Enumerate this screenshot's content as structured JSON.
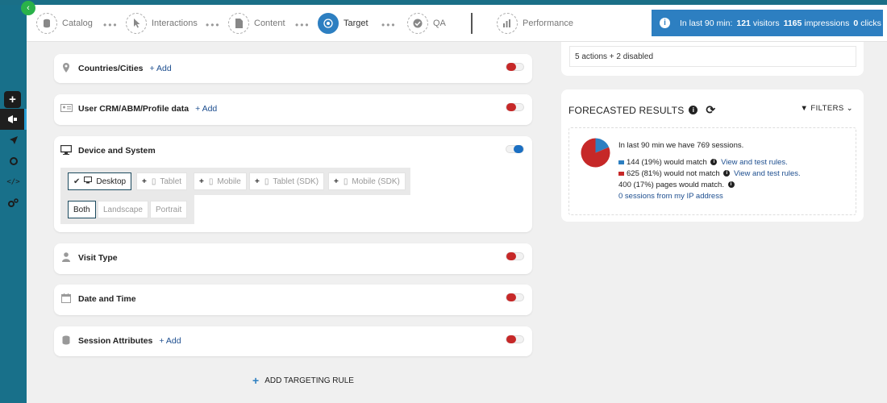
{
  "header": {
    "steps": [
      {
        "label": "Catalog",
        "icon": "database-icon"
      },
      {
        "label": "Interactions",
        "icon": "cursor-icon"
      },
      {
        "label": "Content",
        "icon": "file-icon"
      },
      {
        "label": "Target",
        "icon": "target-icon",
        "active": true
      },
      {
        "label": "QA",
        "icon": "check-circle-icon"
      },
      {
        "label": "Performance",
        "icon": "bar-chart-icon"
      }
    ],
    "stats": {
      "prefix": "In last 90 min:",
      "visitors_count": "121",
      "visitors_label": "visitors",
      "impressions_count": "1165",
      "impressions_label": "impressions",
      "clicks_count": "0",
      "clicks_label": "clicks"
    }
  },
  "sidebar": {
    "items": [
      "plus-icon",
      "megaphone-icon",
      "rocket-icon",
      "network-icon",
      "code-icon",
      "gears-icon"
    ]
  },
  "rules": {
    "countries": {
      "title": "Countries/Cities",
      "add": "+ Add",
      "enabled": false
    },
    "crm": {
      "title": "User CRM/ABM/Profile data",
      "add": "+ Add",
      "enabled": false
    },
    "device": {
      "title": "Device and System",
      "enabled": true,
      "devices": [
        "Desktop",
        "Tablet",
        "Mobile",
        "Tablet (SDK)",
        "Mobile (SDK)"
      ],
      "selected_device": "Desktop",
      "orientations": [
        "Both",
        "Landscape",
        "Portrait"
      ],
      "selected_orientation": "Both"
    },
    "visit_type": {
      "title": "Visit Type",
      "enabled": false
    },
    "date_time": {
      "title": "Date and Time",
      "enabled": false
    },
    "session": {
      "title": "Session Attributes",
      "add": "+ Add",
      "enabled": false
    },
    "add_rule_label": "ADD TARGETING RULE"
  },
  "right": {
    "actions_summary": "5 actions + 2 disabled",
    "forecast": {
      "title": "FORECASTED RESULTS",
      "filters_label": "FILTERS",
      "sessions_line": "In last 90 min we have 769 sessions.",
      "match_line": "144 (19%) would match",
      "nomatch_line": "625 (81%) would not match",
      "view_rules": "View and test rules.",
      "pages_line": "400 (17%) pages would match.",
      "ip_link": "0 sessions from my IP address",
      "colors": {
        "match": "#2d7fc1",
        "nomatch": "#c62828"
      }
    }
  },
  "chart_data": {
    "type": "pie",
    "categories": [
      "would match",
      "would not match"
    ],
    "values": [
      144,
      625
    ]
  }
}
